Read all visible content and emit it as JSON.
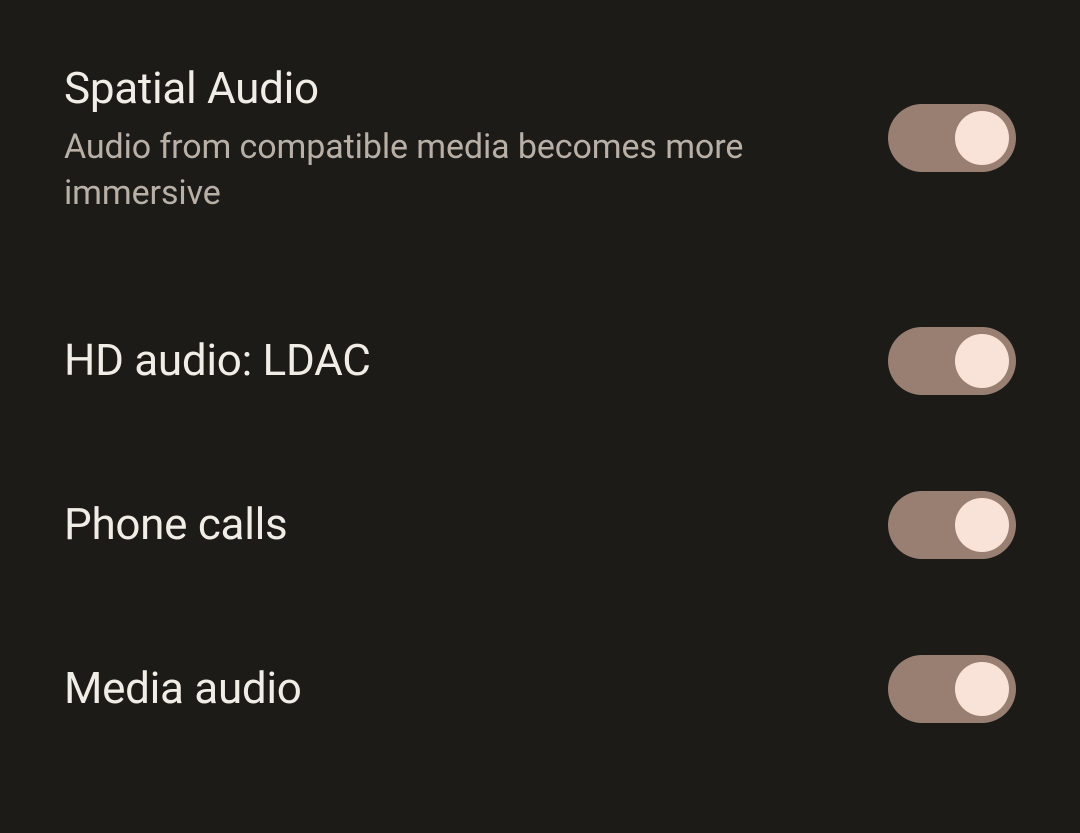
{
  "settings": [
    {
      "title": "Spatial Audio",
      "description": "Audio from compatible media becomes more immersive",
      "enabled": true
    },
    {
      "title": "HD audio: LDAC",
      "description": "",
      "enabled": true
    },
    {
      "title": "Phone calls",
      "description": "",
      "enabled": true
    },
    {
      "title": "Media audio",
      "description": "",
      "enabled": true
    }
  ],
  "colors": {
    "background": "#1c1b18",
    "titleText": "#f0ece6",
    "descriptionText": "#b8b0a7",
    "toggleTrackOn": "#997f72",
    "toggleThumbOn": "#f9e3d8"
  }
}
